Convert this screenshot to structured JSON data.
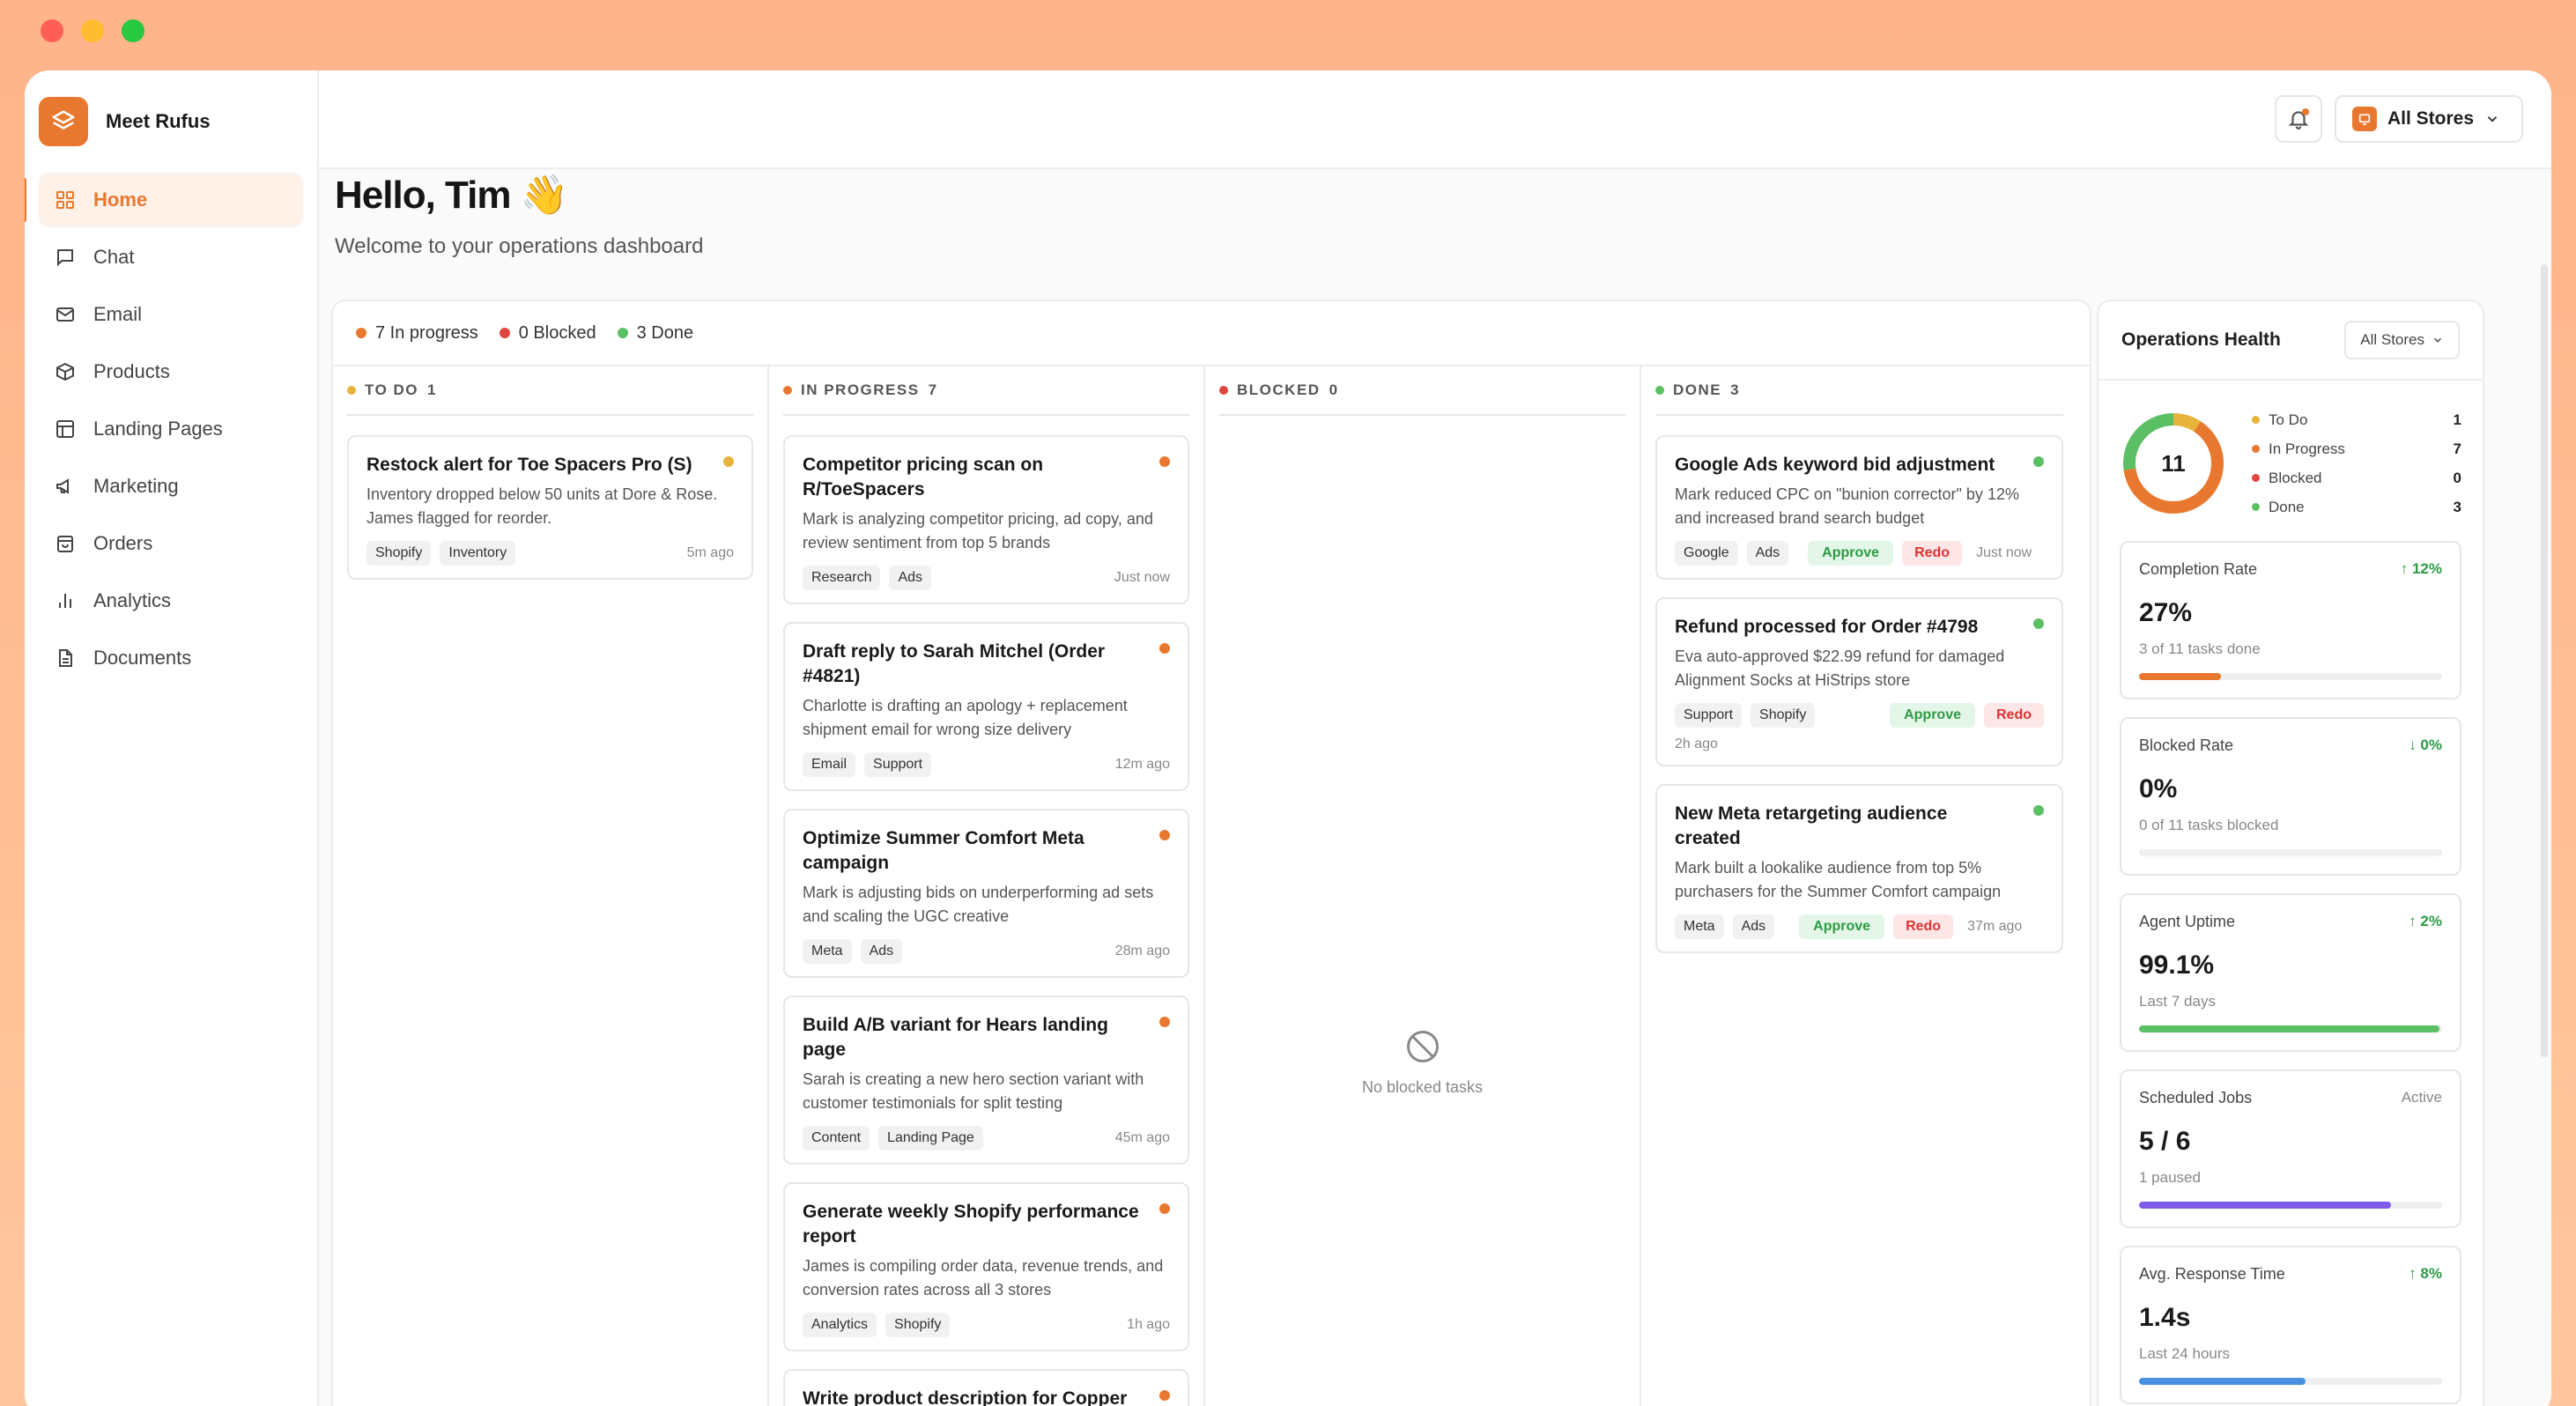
{
  "window": {
    "traffic_lights": [
      "#ff5f57",
      "#febc2e",
      "#28c840"
    ]
  },
  "brand": {
    "name": "Meet Rufus",
    "accent": "#e8782f"
  },
  "sidebar": {
    "items": [
      {
        "label": "Home",
        "icon": "grid-icon",
        "active": true
      },
      {
        "label": "Chat",
        "icon": "chat-bubble-icon"
      },
      {
        "label": "Email",
        "icon": "mail-icon"
      },
      {
        "label": "Products",
        "icon": "box-icon"
      },
      {
        "label": "Landing Pages",
        "icon": "layout-icon"
      },
      {
        "label": "Marketing",
        "icon": "megaphone-icon"
      },
      {
        "label": "Orders",
        "icon": "shopping-bag-icon"
      },
      {
        "label": "Analytics",
        "icon": "bar-chart-icon"
      },
      {
        "label": "Documents",
        "icon": "document-icon"
      }
    ]
  },
  "topbar": {
    "store_selector": "All Stores"
  },
  "header": {
    "title": "Hello, Tim",
    "emoji": "👋",
    "subtitle": "Welcome to your operations dashboard"
  },
  "summary": {
    "in_progress": "7 In progress",
    "blocked": "0 Blocked",
    "done": "3 Done"
  },
  "colors": {
    "todo": "#e8b33c",
    "in_progress": "#e8782f",
    "blocked": "#e0443e",
    "done": "#5bbf63"
  },
  "columns": {
    "todo": {
      "label": "TO DO",
      "count": "1"
    },
    "in_progress": {
      "label": "IN PROGRESS",
      "count": "7"
    },
    "blocked": {
      "label": "BLOCKED",
      "count": "0",
      "empty": "No blocked tasks"
    },
    "done": {
      "label": "DONE",
      "count": "3"
    }
  },
  "todo_cards": [
    {
      "title": "Restock alert for Toe Spacers Pro (S)",
      "desc": "Inventory dropped below 50 units at Dore & Rose. James flagged for reorder.",
      "tags": [
        "Shopify",
        "Inventory"
      ],
      "time": "5m ago"
    }
  ],
  "progress_cards": [
    {
      "title": "Competitor pricing scan on R/ToeSpacers",
      "desc": "Mark is analyzing competitor pricing, ad copy, and review sentiment from top 5 brands",
      "tags": [
        "Research",
        "Ads"
      ],
      "time": "Just now"
    },
    {
      "title": "Draft reply to Sarah Mitchel (Order #4821)",
      "desc": "Charlotte is drafting an apology + replacement shipment email for wrong size delivery",
      "tags": [
        "Email",
        "Support"
      ],
      "time": "12m ago"
    },
    {
      "title": "Optimize Summer Comfort Meta campaign",
      "desc": "Mark is adjusting bids on underperforming ad sets and scaling the UGC creative",
      "tags": [
        "Meta",
        "Ads"
      ],
      "time": "28m ago"
    },
    {
      "title": "Build A/B variant for Hears landing page",
      "desc": "Sarah is creating a new hero section variant with customer testimonials for split testing",
      "tags": [
        "Content",
        "Landing Page"
      ],
      "time": "45m ago"
    },
    {
      "title": "Generate weekly Shopify performance report",
      "desc": "James is compiling order data, revenue trends, and conversion rates across all 3 stores",
      "tags": [
        "Analytics",
        "Shopify"
      ],
      "time": "1h ago"
    },
    {
      "title": "Write product description for Copper Socks",
      "desc": "",
      "tags": [],
      "time": ""
    }
  ],
  "done_cards": [
    {
      "title": "Google Ads keyword bid adjustment",
      "desc": "Mark reduced CPC on \"bunion corrector\" by 12% and increased brand search budget",
      "tags": [
        "Google",
        "Ads"
      ],
      "approve": "Approve",
      "redo": "Redo",
      "time": "Just now"
    },
    {
      "title": "Refund processed for Order #4798",
      "desc": "Eva auto-approved $22.99 refund for damaged Alignment Socks at HiStrips store",
      "tags": [
        "Support",
        "Shopify"
      ],
      "approve": "Approve",
      "redo": "Redo",
      "time": "2h ago"
    },
    {
      "title": "New Meta retargeting audience created",
      "desc": "Mark built a lookalike audience from top 5% purchasers for the Summer Comfort campaign",
      "tags": [
        "Meta",
        "Ads"
      ],
      "approve": "Approve",
      "redo": "Redo",
      "time": "37m ago"
    }
  ],
  "health": {
    "title": "Operations Health",
    "store_filter": "All Stores",
    "total": "11",
    "legend": [
      {
        "label": "To Do",
        "count": "1"
      },
      {
        "label": "In Progress",
        "count": "7"
      },
      {
        "label": "Blocked",
        "count": "0"
      },
      {
        "label": "Done",
        "count": "3"
      }
    ],
    "metrics": [
      {
        "label": "Completion Rate",
        "delta": "↑ 12%",
        "value": "27%",
        "sub": "3 of 11 tasks done",
        "fill": 0.27,
        "color": "#e8782f"
      },
      {
        "label": "Blocked Rate",
        "delta": "↓ 0%",
        "value": "0%",
        "sub": "0 of 11 tasks blocked",
        "fill": 0,
        "color": "#e0443e"
      },
      {
        "label": "Agent Uptime",
        "delta": "↑ 2%",
        "value": "99.1%",
        "sub": "Last 7 days",
        "fill": 0.991,
        "color": "#5bbf63"
      },
      {
        "label": "Scheduled Jobs",
        "delta": "Active",
        "value": "5 / 6",
        "sub": "1 paused",
        "fill": 0.83,
        "color": "#7c5ce8"
      },
      {
        "label": "Avg. Response Time",
        "delta": "↑ 8%",
        "value": "1.4s",
        "sub": "Last 24 hours",
        "fill": 0.55,
        "color": "#4a90e2"
      }
    ]
  }
}
